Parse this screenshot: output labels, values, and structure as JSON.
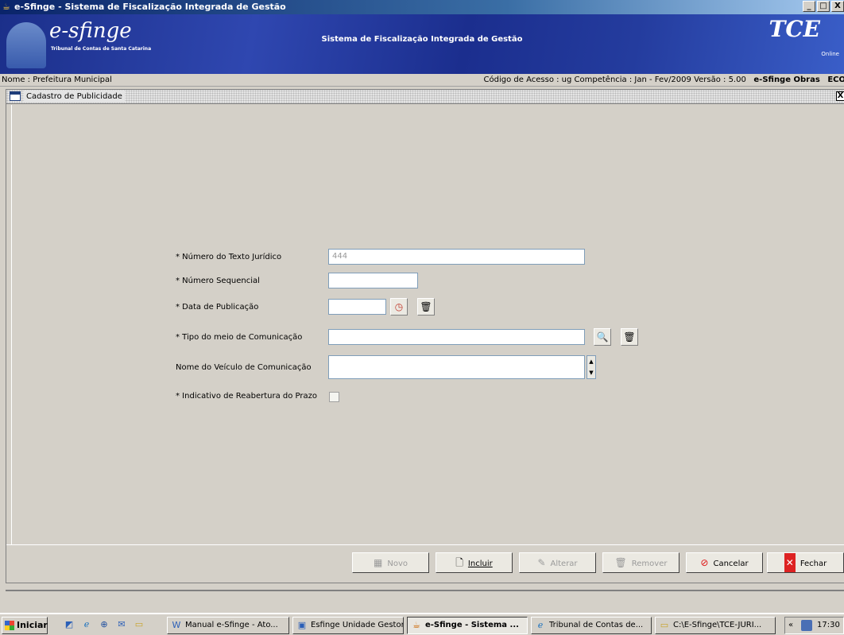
{
  "window": {
    "title": "e-Sfinge - Sistema de Fiscalização Integrada de Gestão",
    "buttons": [
      "_",
      "□",
      "X"
    ]
  },
  "banner": {
    "logo": "e-sfinge",
    "logo_subtitle": "Tribunal de Contas de Santa Catarina",
    "system_name": "Sistema de Fiscalização Integrada de Gestão",
    "tce_logo": "TCE",
    "tce_online": "Online"
  },
  "infobar": {
    "name": "Nome : Prefeitura Municipal",
    "access": "Código de Acesso : ug  Competência : Jan - Fev/2009  Versão : 5.00",
    "module": "e-Sfinge Obras",
    "extra": "ECO"
  },
  "frame": {
    "title": "Cadastro de Publicidade",
    "close": "X"
  },
  "form": {
    "numero_texto_label": "* Número do Texto Jurídico",
    "numero_texto_value": "444",
    "numero_sequencial_label": "* Número Sequencial",
    "numero_sequencial_value": "",
    "data_publicacao_label": "* Data de Publicação",
    "data_publicacao_value": "",
    "tipo_meio_label": "* Tipo do meio de Comunicação",
    "tipo_meio_value": "",
    "nome_veiculo_label": "Nome do Veículo de Comunicação",
    "nome_veiculo_value": "",
    "reabertura_label": "* Indicativo de Reabertura do Prazo",
    "reabertura_checked": false
  },
  "toolbar": {
    "novo": "Novo",
    "incluir": "Incluir",
    "alterar": "Alterar",
    "remover": "Remover",
    "cancelar": "Cancelar",
    "fechar": "Fechar"
  },
  "taskbar": {
    "start": "Iniciar",
    "tasks": [
      "Manual e-Sfinge - Ato...",
      "Esfinge Unidade Gestora",
      "e-Sfinge - Sistema ...",
      "Tribunal de Contas de...",
      "C:\\E-Sfinge\\TCE-JURI..."
    ],
    "tray_chevron": "«",
    "clock": "17:30"
  }
}
